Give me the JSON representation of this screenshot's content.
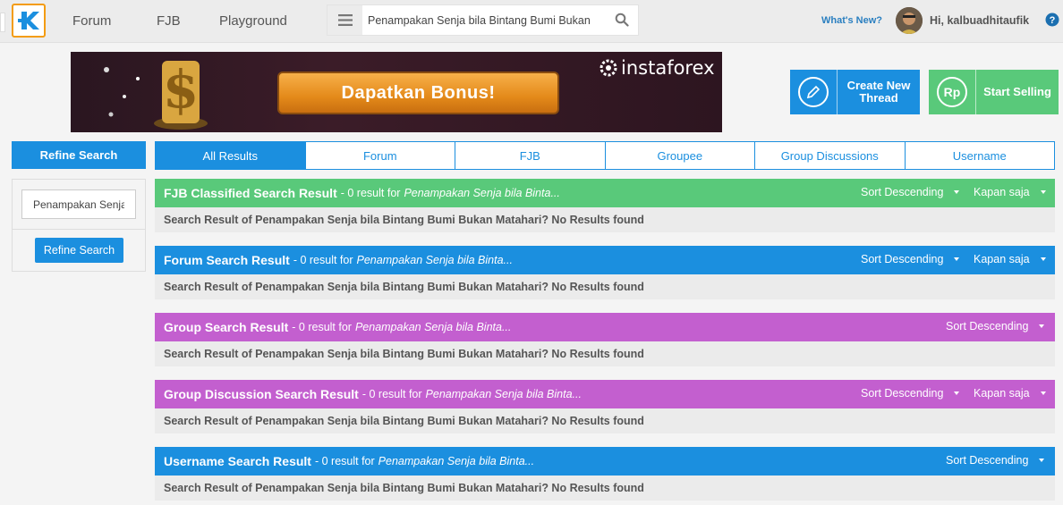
{
  "nav": {
    "links": [
      "Forum",
      "FJB",
      "Playground"
    ],
    "search_value": "Penampakan Senja bila Bintang Bumi Bukan",
    "whats_new": "What's New?",
    "greeting": "Hi, kalbuadhitaufik"
  },
  "banner": {
    "button_label": "Dapatkan Bonus!",
    "brand": "instaforex"
  },
  "actions": {
    "create_line1": "Create New",
    "create_line2": "Thread",
    "sell_label": "Start Selling",
    "sell_icon_text": "Rp"
  },
  "sidebar": {
    "header": "Refine Search",
    "input_value": "Penampakan Senja bila Bintang Bumi Bukan Matahari?",
    "button_label": "Refine Search"
  },
  "tabs": [
    "All Results",
    "Forum",
    "FJB",
    "Groupee",
    "Group Discussions",
    "Username"
  ],
  "results": [
    {
      "title": "FJB Classified Search Result",
      "count": "- 0 result for",
      "query": "Penampakan Senja bila Binta...",
      "sort": "Sort Descending",
      "time": "Kapan saja",
      "color": "#59c97a",
      "body": "Search Result of Penampakan Senja bila Bintang Bumi Bukan Matahari? No Results found"
    },
    {
      "title": "Forum Search Result",
      "count": "- 0 result for",
      "query": "Penampakan Senja bila Binta...",
      "sort": "Sort Descending",
      "time": "Kapan saja",
      "color": "#1b8fdf",
      "body": "Search Result of Penampakan Senja bila Bintang Bumi Bukan Matahari? No Results found"
    },
    {
      "title": "Group Search Result",
      "count": "- 0 result for",
      "query": "Penampakan Senja bila Binta...",
      "sort": "Sort Descending",
      "time": "",
      "color": "#c35fcf",
      "body": "Search Result of Penampakan Senja bila Bintang Bumi Bukan Matahari? No Results found"
    },
    {
      "title": "Group Discussion Search Result",
      "count": "- 0 result for",
      "query": "Penampakan Senja bila Binta...",
      "sort": "Sort Descending",
      "time": "Kapan saja",
      "color": "#c35fcf",
      "body": "Search Result of Penampakan Senja bila Bintang Bumi Bukan Matahari? No Results found"
    },
    {
      "title": "Username Search Result",
      "count": "- 0 result for",
      "query": "Penampakan Senja bila Binta...",
      "sort": "Sort Descending",
      "time": "",
      "color": "#1b8fdf",
      "body": "Search Result of Penampakan Senja bila Bintang Bumi Bukan Matahari? No Results found"
    }
  ],
  "icons": {
    "logo": "kaskus-logo-icon",
    "menu": "hamburger-menu-icon",
    "search": "search-icon",
    "help": "help-icon",
    "pencil": "pencil-icon"
  }
}
